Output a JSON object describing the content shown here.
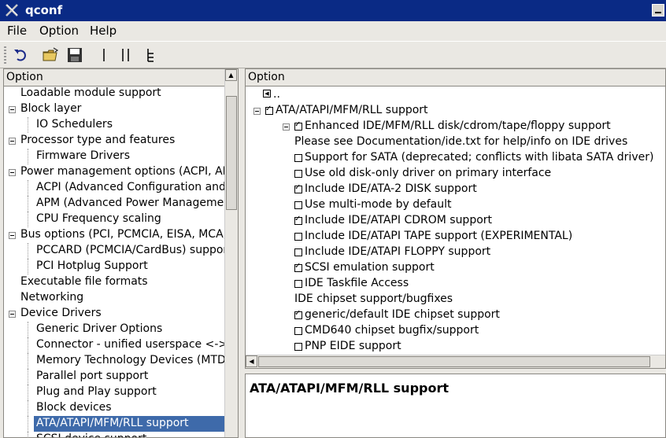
{
  "window": {
    "title": "qconf"
  },
  "menu": {
    "file": "File",
    "option": "Option",
    "help": "Help"
  },
  "toolbar": {
    "icons": [
      "undo-icon",
      "open-folder-icon",
      "save-disk-icon",
      "single-view-icon",
      "split-view-icon",
      "full-view-icon"
    ]
  },
  "left_panel": {
    "header": "Option",
    "items": [
      {
        "label": "Loadable module support",
        "indent": 0,
        "expander": false
      },
      {
        "label": "Block layer",
        "indent": 0,
        "expander": true
      },
      {
        "label": "IO Schedulers",
        "indent": 1,
        "expander": false
      },
      {
        "label": "Processor type and features",
        "indent": 0,
        "expander": true
      },
      {
        "label": "Firmware Drivers",
        "indent": 1,
        "expander": false
      },
      {
        "label": "Power management options (ACPI, APM)",
        "indent": 0,
        "expander": true
      },
      {
        "label": "ACPI (Advanced Configuration and Power Interface) Support",
        "indent": 1,
        "expander": false
      },
      {
        "label": "APM (Advanced Power Management) BIOS Support",
        "indent": 1,
        "expander": false
      },
      {
        "label": "CPU Frequency scaling",
        "indent": 1,
        "expander": false
      },
      {
        "label": "Bus options (PCI, PCMCIA, EISA, MCA, ISA)",
        "indent": 0,
        "expander": true
      },
      {
        "label": "PCCARD (PCMCIA/CardBus) support",
        "indent": 1,
        "expander": false
      },
      {
        "label": "PCI Hotplug Support",
        "indent": 1,
        "expander": false
      },
      {
        "label": "Executable file formats",
        "indent": 0,
        "expander": false
      },
      {
        "label": "Networking",
        "indent": 0,
        "expander": false
      },
      {
        "label": "Device Drivers",
        "indent": 0,
        "expander": true
      },
      {
        "label": "Generic Driver Options",
        "indent": 1,
        "expander": false
      },
      {
        "label": "Connector - unified userspace <-> kernelspace linker",
        "indent": 1,
        "expander": false
      },
      {
        "label": "Memory Technology Devices (MTD)",
        "indent": 1,
        "expander": false
      },
      {
        "label": "Parallel port support",
        "indent": 1,
        "expander": false
      },
      {
        "label": "Plug and Play support",
        "indent": 1,
        "expander": false
      },
      {
        "label": "Block devices",
        "indent": 1,
        "expander": false
      },
      {
        "label": "ATA/ATAPI/MFM/RLL support",
        "indent": 1,
        "expander": false,
        "selected": true
      },
      {
        "label": "SCSI device support",
        "indent": 1,
        "expander": false
      }
    ]
  },
  "right_panel": {
    "header": "Option",
    "items": [
      {
        "label": "..",
        "kind": "up",
        "indent": 0
      },
      {
        "label": "ATA/ATAPI/MFM/RLL support",
        "kind": "check",
        "checked": true,
        "expander": true,
        "indent": 0
      },
      {
        "label": "Enhanced IDE/MFM/RLL disk/cdrom/tape/floppy support",
        "kind": "check",
        "checked": true,
        "expander": true,
        "indent": 1
      },
      {
        "label": "Please see Documentation/ide.txt for help/info on IDE drives",
        "kind": "text",
        "indent": 2
      },
      {
        "label": "Support for SATA (deprecated; conflicts with libata SATA driver)",
        "kind": "check",
        "checked": false,
        "indent": 2
      },
      {
        "label": "Use old disk-only driver on primary interface",
        "kind": "check",
        "checked": false,
        "indent": 2
      },
      {
        "label": "Include IDE/ATA-2 DISK support",
        "kind": "check",
        "checked": true,
        "indent": 2
      },
      {
        "label": "Use multi-mode by default",
        "kind": "check",
        "checked": false,
        "indent": 2
      },
      {
        "label": "Include IDE/ATAPI CDROM support",
        "kind": "check",
        "checked": true,
        "indent": 2
      },
      {
        "label": "Include IDE/ATAPI TAPE support (EXPERIMENTAL)",
        "kind": "check",
        "checked": false,
        "indent": 2
      },
      {
        "label": "Include IDE/ATAPI FLOPPY support",
        "kind": "check",
        "checked": false,
        "indent": 2
      },
      {
        "label": "SCSI emulation support",
        "kind": "check",
        "checked": true,
        "indent": 2
      },
      {
        "label": "IDE Taskfile Access",
        "kind": "check",
        "checked": false,
        "indent": 2
      },
      {
        "label": "IDE chipset support/bugfixes",
        "kind": "text",
        "indent": 2
      },
      {
        "label": "generic/default IDE chipset support",
        "kind": "check",
        "checked": true,
        "indent": 2
      },
      {
        "label": "CMD640 chipset bugfix/support",
        "kind": "check",
        "checked": false,
        "indent": 2
      },
      {
        "label": "PNP EIDE support",
        "kind": "check",
        "checked": false,
        "indent": 2
      }
    ]
  },
  "description": {
    "title": "ATA/ATAPI/MFM/RLL support"
  }
}
